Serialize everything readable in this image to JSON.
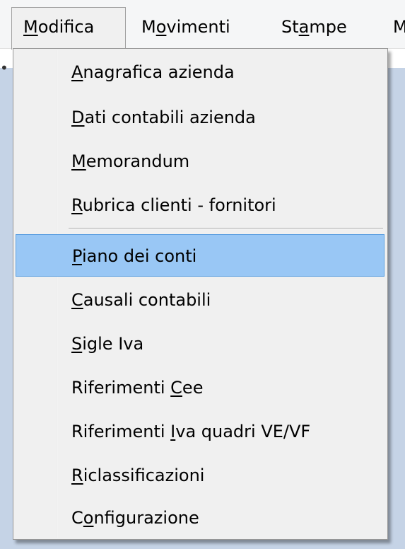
{
  "menubar": {
    "items": [
      {
        "text": "Modifica",
        "mnemonic_index": 0
      },
      {
        "text": "Movimenti",
        "mnemonic_index": 1
      },
      {
        "text": "Stampe",
        "mnemonic_index": 2
      },
      {
        "text": "M",
        "mnemonic_index": -1
      }
    ],
    "active": "Modifica"
  },
  "dropdown": {
    "items": [
      {
        "text": "Anagrafica azienda",
        "mnemonic_index": 0
      },
      {
        "text": "Dati contabili azienda",
        "mnemonic_index": 0
      },
      {
        "text": "Memorandum",
        "mnemonic_index": 0
      },
      {
        "text": "Rubrica clienti - fornitori",
        "mnemonic_index": 0,
        "separator_after": true
      },
      {
        "text": "Piano dei conti",
        "mnemonic_index": 0,
        "selected": true
      },
      {
        "text": "Causali contabili",
        "mnemonic_index": 0
      },
      {
        "text": "Sigle Iva",
        "mnemonic_index": 0
      },
      {
        "text": "Riferimenti Cee",
        "mnemonic_index": 12
      },
      {
        "text": "Riferimenti Iva quadri VE/VF",
        "mnemonic_index": 12
      },
      {
        "text": "Riclassificazioni",
        "mnemonic_index": 0
      },
      {
        "text": "Configurazione",
        "mnemonic_index": 1
      }
    ]
  },
  "colors": {
    "menu_bg": "#f0f0f0",
    "selection_bg": "#99c7f5",
    "selection_border": "#5a9ee0",
    "app_bg_blue": "#c5d3e6"
  }
}
